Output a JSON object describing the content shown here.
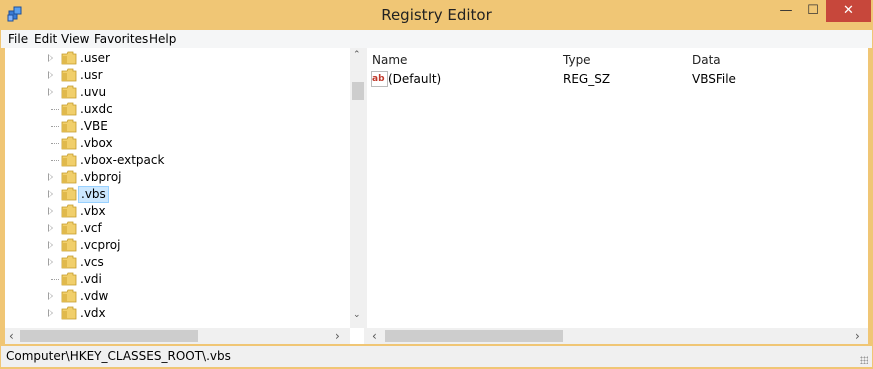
{
  "window": {
    "title": "Registry Editor",
    "icon": "registry-icon"
  },
  "controls": {
    "minimize": "—",
    "maximize": "☐",
    "close": "✕"
  },
  "menu": [
    "File",
    "Edit",
    "View",
    "Favorites",
    "Help"
  ],
  "tree": {
    "items": [
      {
        "label": ".user",
        "expandable": true,
        "selected": false
      },
      {
        "label": ".usr",
        "expandable": true,
        "selected": false
      },
      {
        "label": ".uvu",
        "expandable": true,
        "selected": false
      },
      {
        "label": ".uxdc",
        "expandable": false,
        "selected": false
      },
      {
        "label": ".VBE",
        "expandable": false,
        "selected": false
      },
      {
        "label": ".vbox",
        "expandable": false,
        "selected": false
      },
      {
        "label": ".vbox-extpack",
        "expandable": false,
        "selected": false
      },
      {
        "label": ".vbproj",
        "expandable": true,
        "selected": false
      },
      {
        "label": ".vbs",
        "expandable": true,
        "selected": true
      },
      {
        "label": ".vbx",
        "expandable": true,
        "selected": false
      },
      {
        "label": ".vcf",
        "expandable": true,
        "selected": false
      },
      {
        "label": ".vcproj",
        "expandable": true,
        "selected": false
      },
      {
        "label": ".vcs",
        "expandable": true,
        "selected": false
      },
      {
        "label": ".vdi",
        "expandable": false,
        "selected": false
      },
      {
        "label": ".vdw",
        "expandable": true,
        "selected": false
      },
      {
        "label": ".vdx",
        "expandable": true,
        "selected": false
      }
    ]
  },
  "values": {
    "columns": {
      "name": "Name",
      "type": "Type",
      "data": "Data"
    },
    "rows": [
      {
        "icon": "string-value-icon",
        "icon_text": "ab",
        "name": "(Default)",
        "type": "REG_SZ",
        "data": "VBSFile"
      }
    ]
  },
  "status": {
    "path": "Computer\\HKEY_CLASSES_ROOT\\.vbs"
  },
  "arrows": {
    "up": "⌃",
    "down": "⌄",
    "left": "‹",
    "right": "›"
  },
  "colors": {
    "frame": "#f0c675",
    "selection": "#cce8ff",
    "close": "#c7473b"
  }
}
